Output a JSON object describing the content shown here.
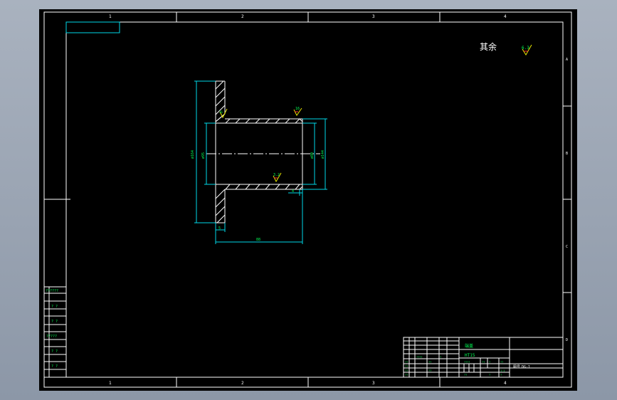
{
  "frame": {
    "col_numbers": [
      "1",
      "2",
      "3",
      "4"
    ],
    "row_letters": [
      "A",
      "B",
      "C",
      "D"
    ]
  },
  "note": {
    "text": "其余",
    "roughness": "6.3"
  },
  "dimensions": {
    "flange_dia": "ø164",
    "bore_dia": "ø95",
    "sleeve_inner_dia": "ø80",
    "sleeve_outer_dia": "ø144",
    "flange_thickness": "5",
    "length": "88",
    "chamfer": "4",
    "roughness_top": "16",
    "roughness_mid": "3.2",
    "roughness_flange": "16"
  },
  "left_table": {
    "rows": [
      "??????",
      "? ?",
      "? ?",
      "?????",
      "? ?",
      "? ?"
    ]
  },
  "title_block": {
    "part_name": "端盖",
    "material": "HT15",
    "drawing_no": "DG-1",
    "drawing_label": "图号",
    "cells": [
      "??",
      "??",
      "????",
      "?",
      "??",
      "??",
      "??",
      "??",
      "????",
      "??",
      "?",
      "??",
      "??",
      "1:1",
      "?",
      "?"
    ]
  }
}
